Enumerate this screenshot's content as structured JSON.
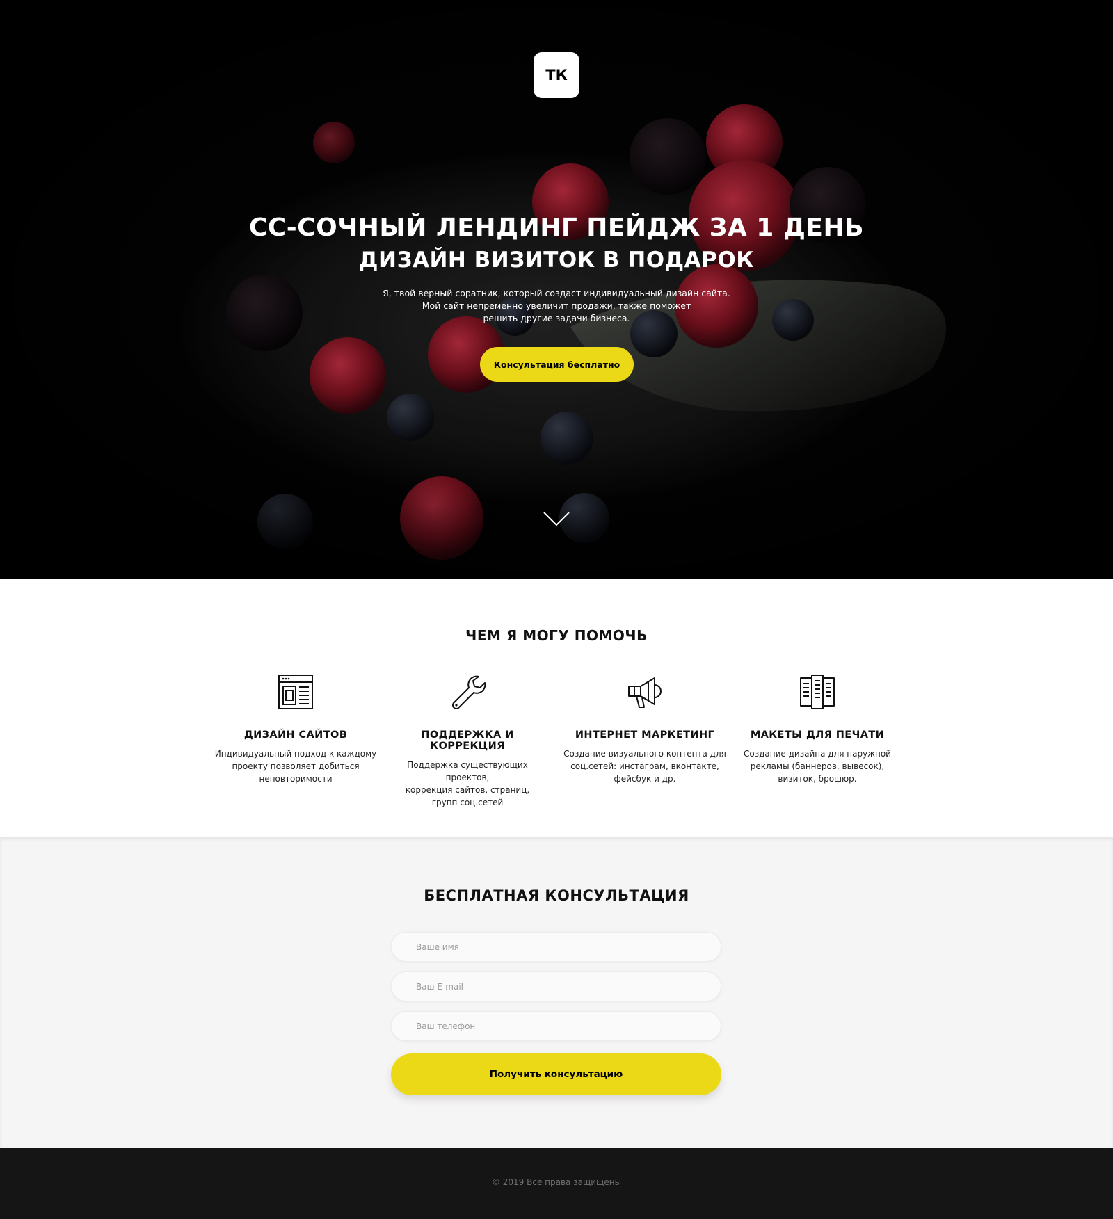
{
  "hero": {
    "logo": "ТК",
    "title": "СС-СОЧНЫЙ ЛЕНДИНГ ПЕЙДЖ ЗА 1 ДЕНЬ",
    "subtitle": "ДИЗАЙН ВИЗИТОК В ПОДАРОК",
    "description": [
      "Я, твой верный соратник, который создаст индивидуальный дизайн сайта.",
      "Мой сайт непременно увеличит продажи, также поможет",
      "решить другие задачи бизнеса."
    ],
    "button_label": "Консультация бесплатно",
    "scroll_icon": "chevron-down-icon"
  },
  "services": {
    "title": "ЧЕМ Я МОГУ ПОМОЧЬ",
    "items": [
      {
        "icon": "browser-layout-icon",
        "title": "ДИЗАЙН САЙТОВ",
        "text": [
          "Индивидуальный подход к каждому",
          "проекту позволяет добиться",
          "неповторимости"
        ]
      },
      {
        "icon": "wrench-icon",
        "title": "ПОДДЕРЖКА И КОРРЕКЦИЯ",
        "text": [
          "Поддержка существующих проектов,",
          "коррекция сайтов, страниц,",
          "групп соц.сетей"
        ]
      },
      {
        "icon": "megaphone-icon",
        "title": "ИНТЕРНЕТ МАРКЕТИНГ",
        "text": [
          "Создание визуального контента для",
          "соц.сетей: инстаграм, вконтакте,",
          "фейсбук и др."
        ]
      },
      {
        "icon": "brochure-icon",
        "title": "МАКЕТЫ ДЛЯ ПЕЧАТИ",
        "text": [
          "Создание дизайна для наружной",
          "рекламы (баннеров, вывесок),",
          "визиток, брошюр."
        ]
      }
    ]
  },
  "consultation": {
    "title": "БЕСПЛАТНАЯ КОНСУЛЬТАЦИЯ",
    "name_placeholder": "Ваше имя",
    "email_placeholder": "Ваш E-mail",
    "phone_placeholder": "Ваш телефон",
    "submit_label": "Получить консультацию"
  },
  "footer": {
    "copyright": "©  2019 Все права защищены"
  },
  "colors": {
    "accent": "#ebd918",
    "hero_bg": "#030303",
    "consult_bg": "#f6f5f5",
    "footer_bg": "#151515"
  }
}
